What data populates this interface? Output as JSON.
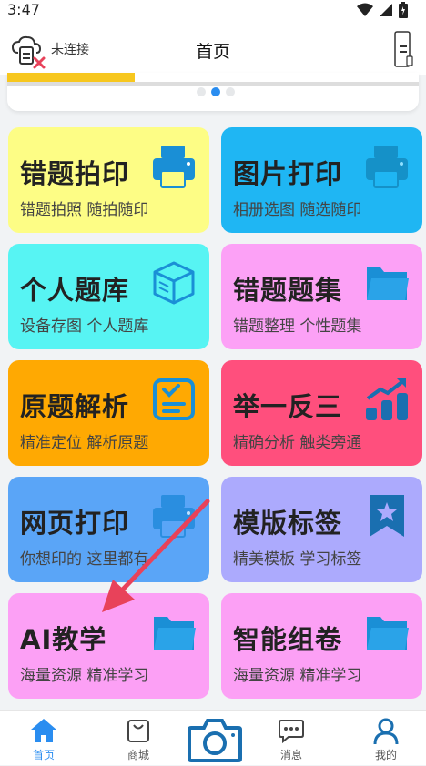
{
  "status_bar": {
    "time": "3:47"
  },
  "header": {
    "device_status": "未连接",
    "title": "首页"
  },
  "cards": [
    {
      "title": "错题拍印",
      "subtitle": "错题拍照 随拍随印",
      "icon": "printer-icon"
    },
    {
      "title": "图片打印",
      "subtitle": "相册选图 随选随印",
      "icon": "printer-icon"
    },
    {
      "title": "个人题库",
      "subtitle": "设备存图 个人题库",
      "icon": "box-icon"
    },
    {
      "title": "错题题集",
      "subtitle": "错题整理 个性题集",
      "icon": "folder-icon"
    },
    {
      "title": "原题解析",
      "subtitle": "精准定位 解析原题",
      "icon": "checklist-icon"
    },
    {
      "title": "举一反三",
      "subtitle": "精确分析 触类旁通",
      "icon": "growth-chart-icon"
    },
    {
      "title": "网页打印",
      "subtitle": "你想印的 这里都有",
      "icon": "printer-icon"
    },
    {
      "title": "模版标签",
      "subtitle": "精美模板 学习标签",
      "icon": "bookmark-star-icon"
    },
    {
      "title": "AI教学",
      "subtitle": "海量资源 精准学习",
      "icon": "folder-icon"
    },
    {
      "title": "智能组卷",
      "subtitle": "海量资源 精准学习",
      "icon": "folder-icon"
    }
  ],
  "tabs": [
    {
      "label": "首页",
      "icon": "home-icon",
      "active": true
    },
    {
      "label": "商城",
      "icon": "shopping-bag-icon"
    },
    {
      "label": "",
      "icon": "camera-icon"
    },
    {
      "label": "消息",
      "icon": "message-icon"
    },
    {
      "label": "我的",
      "icon": "user-icon"
    }
  ],
  "colors": {
    "accent": "#2a8df0",
    "card_yellow": "#fdfd85",
    "card_blue": "#1fb6f3",
    "card_cyan": "#57f4f3",
    "card_pink": "#fca1f6",
    "card_orange": "#ffa902",
    "card_red": "#ff4f7d",
    "card_lightblue": "#5aa5f7",
    "card_purple": "#acaafd",
    "arrow": "#e8425a"
  }
}
